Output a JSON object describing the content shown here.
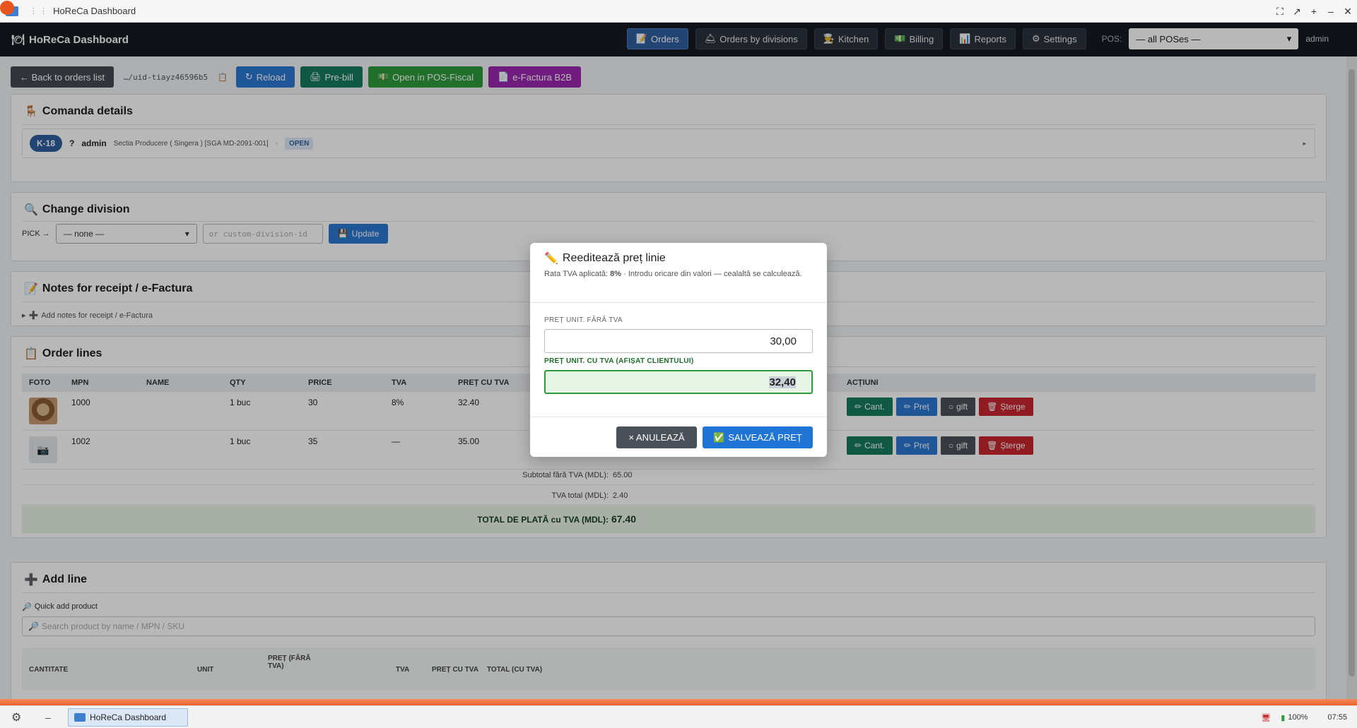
{
  "window": {
    "title": "HoReCa Dashboard"
  },
  "appbar": {
    "brand": "HoReCa Dashboard",
    "nav": [
      {
        "label": "Orders",
        "icon": "edit-icon",
        "active": true
      },
      {
        "label": "Orders by divisions",
        "icon": "bell-icon",
        "active": false
      },
      {
        "label": "Kitchen",
        "icon": "chef-icon",
        "active": false
      },
      {
        "label": "Billing",
        "icon": "money-icon",
        "active": false
      },
      {
        "label": "Reports",
        "icon": "chart-icon",
        "active": false
      },
      {
        "label": "Settings",
        "icon": "gear-icon",
        "active": false
      }
    ],
    "pos_label": "POS:",
    "pos_value": "— all POSes —",
    "user": "admin"
  },
  "toolbar": {
    "back": "← Back to orders list",
    "uid": "…/uid-tiayz46596b5",
    "reload": "Reload",
    "prebill": "Pre-bill",
    "posfiscal": "Open in POS-Fiscal",
    "efactura": "e-Factura B2B"
  },
  "details": {
    "title": "Comanda details",
    "table": "K-18",
    "q": "?",
    "user": "admin",
    "division": "Sectia Producere ( Singera ) [SGA MD-2091-001]",
    "dash": "-",
    "status": "OPEN"
  },
  "division": {
    "title": "Change division",
    "pick": "PICK →",
    "select": "— none —",
    "placeholder": "or custom-division-id",
    "update": "Update"
  },
  "notes": {
    "title": "Notes for receipt / e-Factura",
    "toggle": "Add notes for receipt / e-Factura"
  },
  "lines": {
    "title": "Order lines",
    "headers": [
      "FOTO",
      "MPN",
      "NAME",
      "QTY",
      "PRICE",
      "TVA",
      "PREȚ CU TVA",
      "",
      "ACȚIUNI"
    ],
    "rows": [
      {
        "mpn": "1000",
        "name": "",
        "qty": "1 buc",
        "price": "30",
        "tva": "8%",
        "pret_tva": "32.40"
      },
      {
        "mpn": "1002",
        "name": "",
        "qty": "1 buc",
        "price": "35",
        "tva": "—",
        "pret_tva": "35.00"
      }
    ],
    "actions": {
      "cant": "Cant.",
      "pret": "Preț",
      "gift": "gift",
      "sterge": "Șterge"
    },
    "subtotal_label": "Subtotal fără TVA (MDL):",
    "subtotal": "65.00",
    "tva_label": "TVA total (MDL):",
    "tva_total": "2.40",
    "total_label": "TOTAL DE PLATĂ cu TVA (MDL):",
    "total": "67.40"
  },
  "addline": {
    "title": "Add line",
    "quick": "Quick add product",
    "search_placeholder": "Search product by name / MPN / SKU",
    "labels": {
      "cantitate": "CANTITATE",
      "unit": "UNIT",
      "pret_fara": "PREȚ (FĂRĂ TVA)",
      "tva": "TVA",
      "pret_cu": "PREȚ CU TVA",
      "total": "TOTAL (CU TVA)"
    }
  },
  "modal": {
    "title": "Reeditează preț linie",
    "subtitle_prefix": "Rata TVA aplicată: ",
    "rate": "8%",
    "subtitle_suffix": " · Introdu oricare din valori — cealaltă se calculează.",
    "label_fara": "PREȚ UNIT. FĂRĂ TVA",
    "value_fara": "30,00",
    "label_cu": "PREȚ UNIT. CU TVA (AFIȘAT CLIENTULUI)",
    "value_cu": "32,40",
    "cancel": "× ANULEAZĂ",
    "save": "SALVEAZĂ PREȚ"
  },
  "taskbar": {
    "window": "HoReCa Dashboard",
    "battery": "100%",
    "clock": "07:55"
  },
  "colors": {
    "accent": "#2a78d2",
    "success": "#2d9a3c",
    "danger": "#c8262f",
    "header": "#161a21"
  }
}
